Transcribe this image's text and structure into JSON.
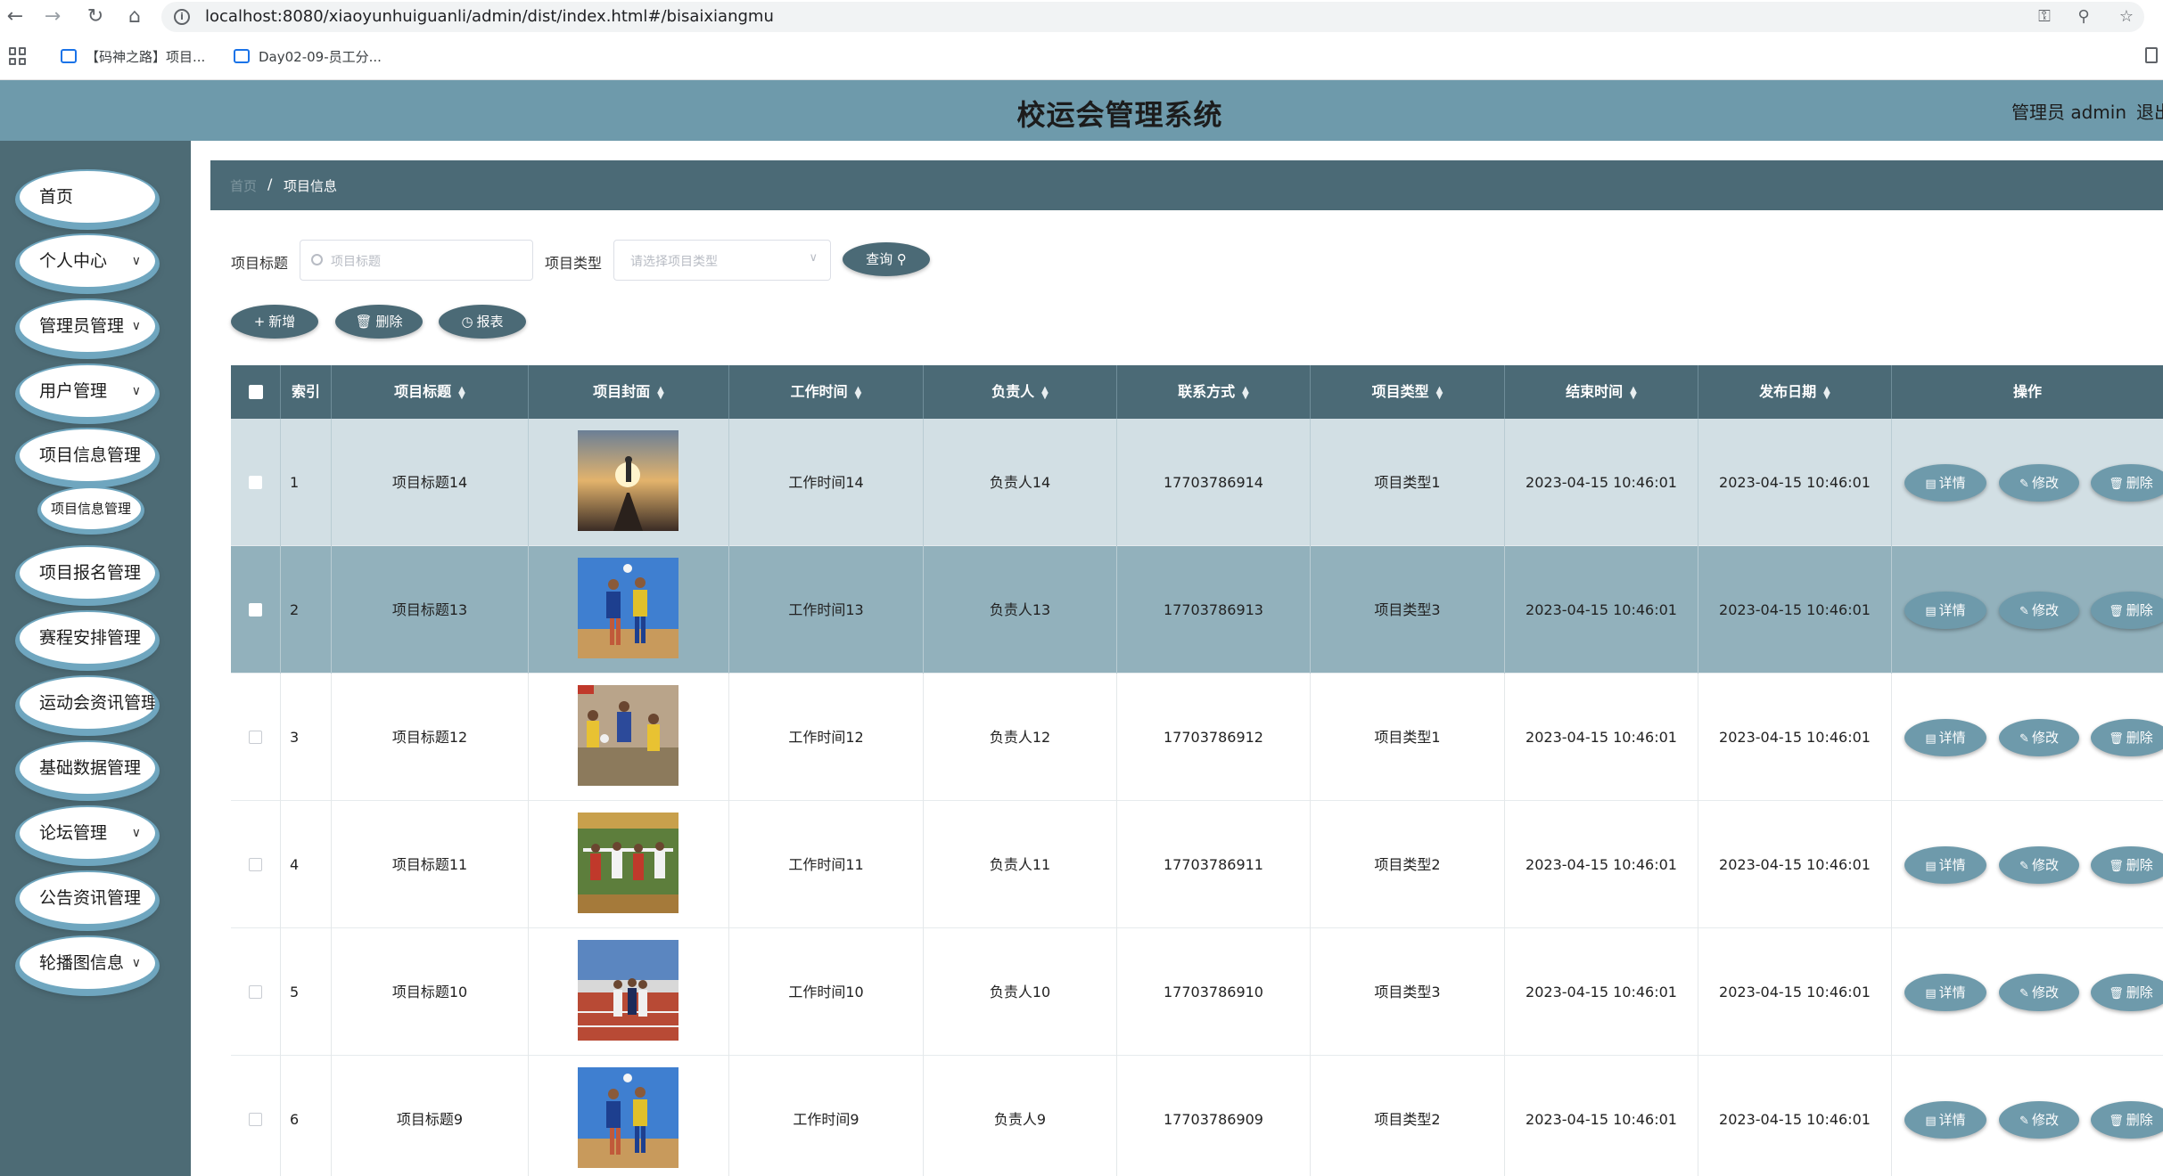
{
  "browser": {
    "url": "localhost:8080/xiaoyunhuiguanli/admin/dist/index.html#/bisaixiangmu",
    "bookmarks": [
      "【码神之路】项目...",
      "Day02-09-员工分..."
    ]
  },
  "header": {
    "title": "校运会管理系统",
    "user": "管理员 admin",
    "logout": "退出"
  },
  "sidebar": {
    "items": [
      {
        "label": "首页",
        "has_arrow": false
      },
      {
        "label": "个人中心",
        "has_arrow": true
      },
      {
        "label": "管理员管理",
        "has_arrow": true
      },
      {
        "label": "用户管理",
        "has_arrow": true
      },
      {
        "label": "项目信息管理",
        "has_arrow": false
      },
      {
        "label": "项目报名管理",
        "has_arrow": false
      },
      {
        "label": "赛程安排管理",
        "has_arrow": false
      },
      {
        "label": "运动会资讯管理",
        "has_arrow": false
      },
      {
        "label": "基础数据管理",
        "has_arrow": false
      },
      {
        "label": "论坛管理",
        "has_arrow": true
      },
      {
        "label": "公告资讯管理",
        "has_arrow": false
      },
      {
        "label": "轮播图信息",
        "has_arrow": true
      }
    ],
    "sub_item": "项目信息管理"
  },
  "breadcrumb": {
    "home": "首页",
    "sep": "/",
    "current": "项目信息"
  },
  "search": {
    "title_label": "项目标题",
    "title_placeholder": "项目标题",
    "type_label": "项目类型",
    "type_placeholder": "请选择项目类型",
    "query_button": "查询"
  },
  "toolbar": {
    "add": "新增",
    "delete": "删除",
    "report": "报表"
  },
  "table": {
    "columns": [
      "索引",
      "项目标题",
      "项目封面",
      "工作时间",
      "负责人",
      "联系方式",
      "项目类型",
      "结束时间",
      "发布日期",
      "操作"
    ],
    "rows": [
      {
        "index": "1",
        "title": "项目标题14",
        "work_time": "工作时间14",
        "owner": "负责人14",
        "phone": "17703786914",
        "type": "项目类型1",
        "end_time": "2023-04-15 10:46:01",
        "publish_date": "2023-04-15 10:46:01"
      },
      {
        "index": "2",
        "title": "项目标题13",
        "work_time": "工作时间13",
        "owner": "负责人13",
        "phone": "17703786913",
        "type": "项目类型3",
        "end_time": "2023-04-15 10:46:01",
        "publish_date": "2023-04-15 10:46:01"
      },
      {
        "index": "3",
        "title": "项目标题12",
        "work_time": "工作时间12",
        "owner": "负责人12",
        "phone": "17703786912",
        "type": "项目类型1",
        "end_time": "2023-04-15 10:46:01",
        "publish_date": "2023-04-15 10:46:01"
      },
      {
        "index": "4",
        "title": "项目标题11",
        "work_time": "工作时间11",
        "owner": "负责人11",
        "phone": "17703786911",
        "type": "项目类型2",
        "end_time": "2023-04-15 10:46:01",
        "publish_date": "2023-04-15 10:46:01"
      },
      {
        "index": "5",
        "title": "项目标题10",
        "work_time": "工作时间10",
        "owner": "负责人10",
        "phone": "17703786910",
        "type": "项目类型3",
        "end_time": "2023-04-15 10:46:01",
        "publish_date": "2023-04-15 10:46:01"
      },
      {
        "index": "6",
        "title": "项目标题9",
        "work_time": "工作时间9",
        "owner": "负责人9",
        "phone": "17703786909",
        "type": "项目类型2",
        "end_time": "2023-04-15 10:46:01",
        "publish_date": "2023-04-15 10:46:01"
      }
    ],
    "actions": {
      "detail": "详情",
      "edit": "修改",
      "delete": "删除"
    }
  },
  "colors": {
    "header": "#6e9aab",
    "sidebar": "#4d6b75",
    "table_header": "#4b6a76",
    "button": "#6e9aab"
  }
}
